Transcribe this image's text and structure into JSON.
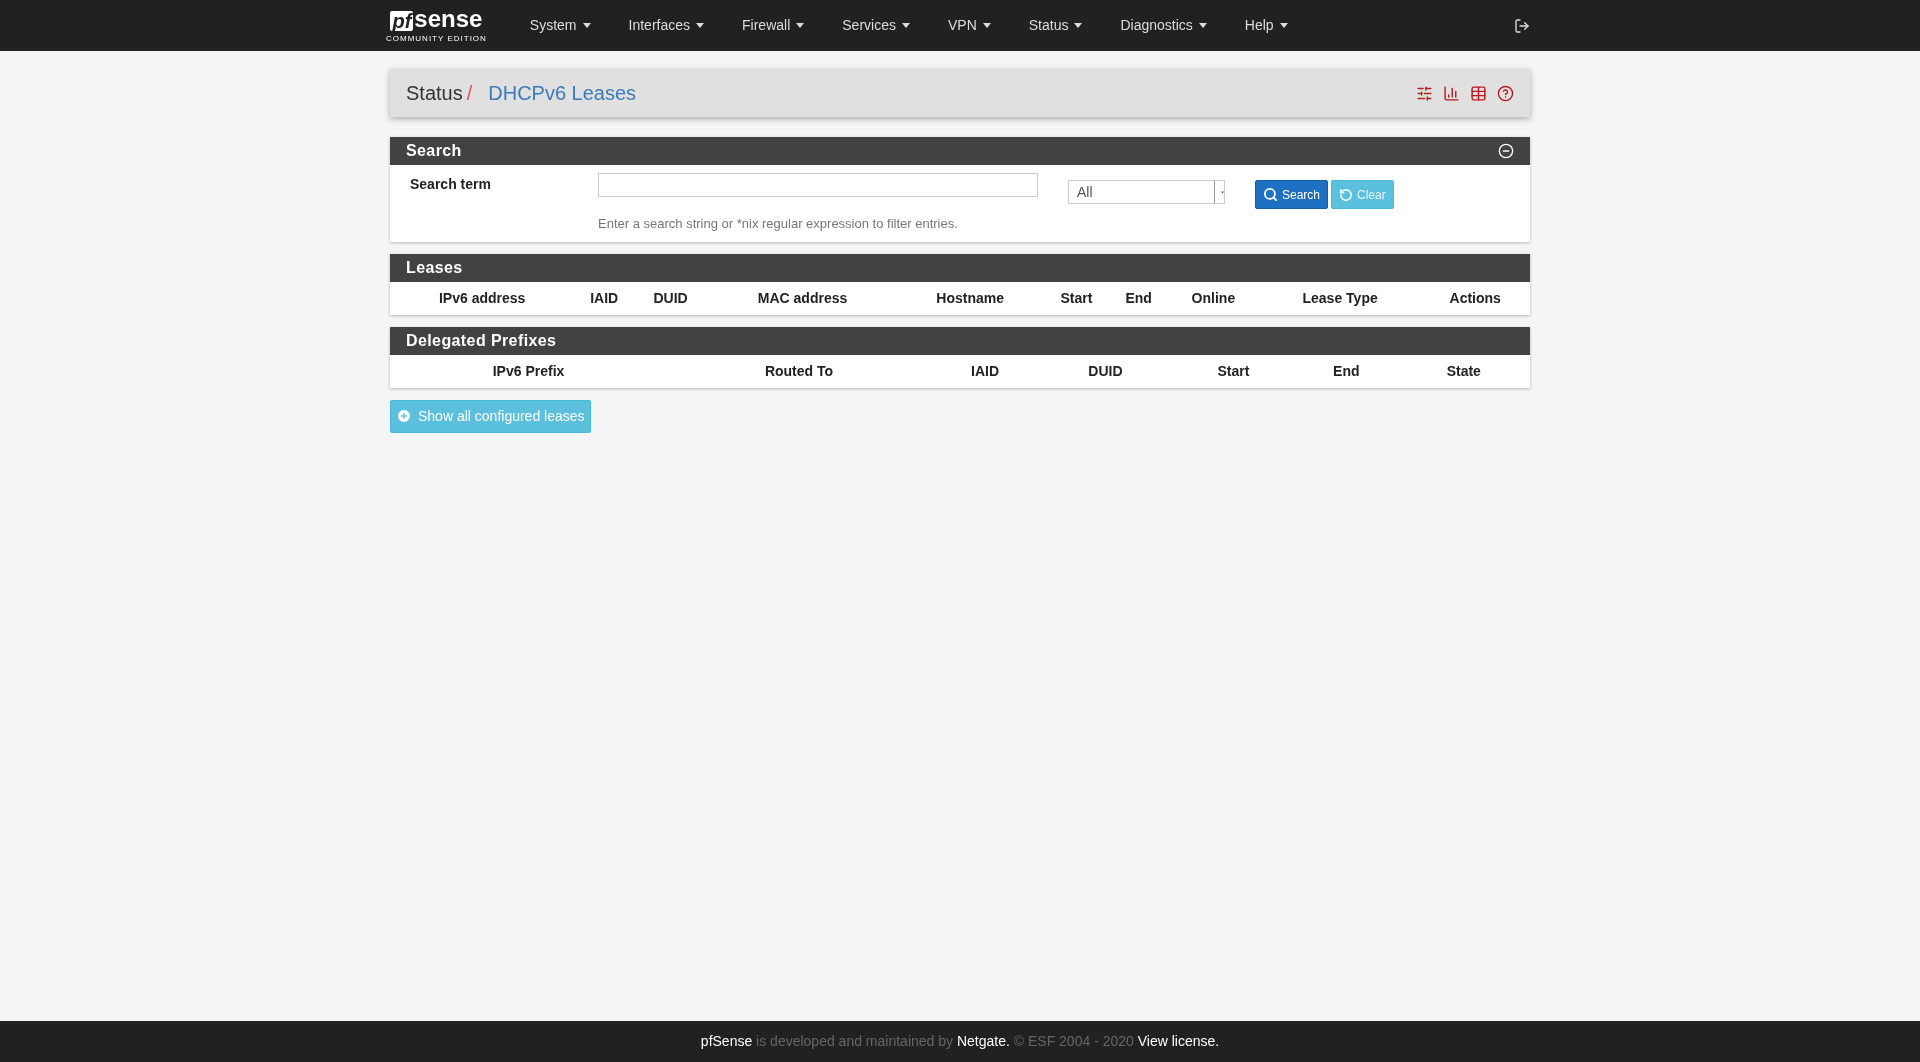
{
  "logo": {
    "mark": "pf",
    "word": "sense",
    "edition": "COMMUNITY EDITION"
  },
  "nav": [
    "System",
    "Interfaces",
    "Firewall",
    "Services",
    "VPN",
    "Status",
    "Diagnostics",
    "Help"
  ],
  "breadcrumb": {
    "parent": "Status",
    "separator": "/",
    "current": "DHCPv6 Leases"
  },
  "search_panel": {
    "title": "Search",
    "label": "Search term",
    "select": "All",
    "help": "Enter a search string or *nix regular expression to filter entries.",
    "buttons": [
      {
        "label": "Search",
        "kind": "primary"
      },
      {
        "label": "Clear",
        "kind": "info"
      }
    ]
  },
  "leases": {
    "title": "Leases",
    "columns": [
      "IPv6 address",
      "IAID",
      "DUID",
      "MAC address",
      "Hostname",
      "Start",
      "End",
      "Online",
      "Lease Type",
      "Actions"
    ]
  },
  "prefixes": {
    "title": "Delegated Prefixes",
    "columns": [
      "IPv6 Prefix",
      "Routed To",
      "IAID",
      "DUID",
      "Start",
      "End",
      "State"
    ]
  },
  "show_all_button": "Show all configured leases",
  "footer": [
    {
      "text": "pfSense",
      "kind": "link"
    },
    {
      "text": "is developed and maintained by",
      "kind": "text"
    },
    {
      "text": "Netgate.",
      "kind": "link"
    },
    {
      "text": "© ESF 2004 - 2020",
      "kind": "text"
    },
    {
      "text": "View license.",
      "kind": "link"
    }
  ]
}
